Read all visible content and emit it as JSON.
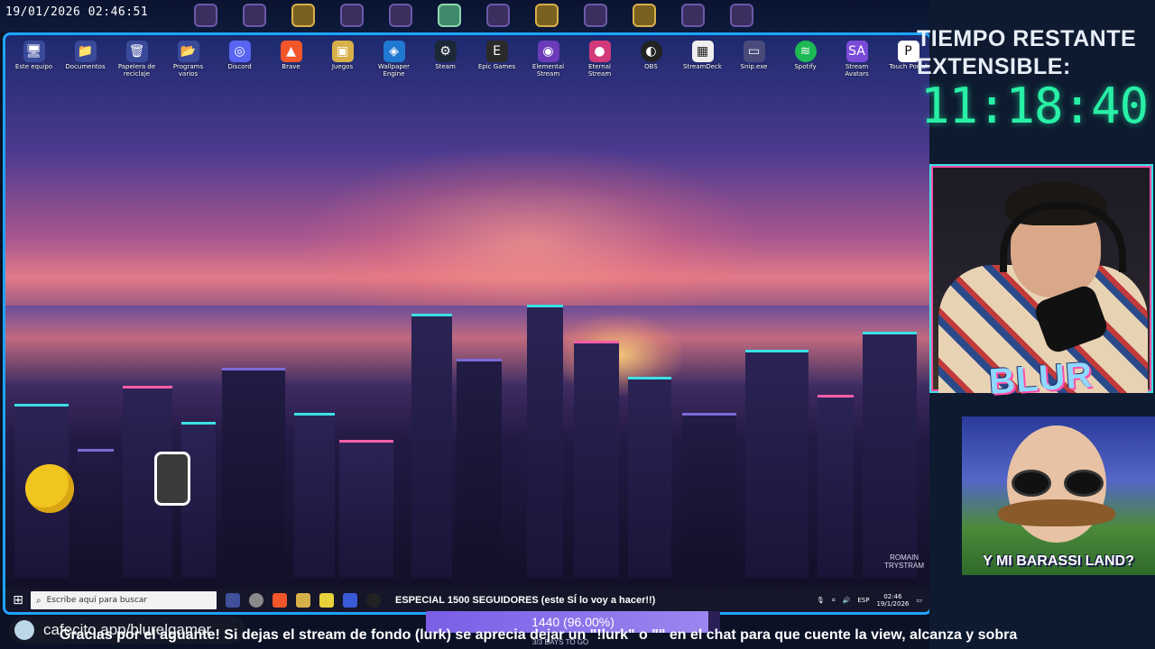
{
  "overlay": {
    "datetime": "19/01/2026 02:46:51",
    "timer_title_line1": "TIEMPO RESTANTE",
    "timer_title_line2": "EXTENSIBLE:",
    "timer_value": "11:18:40",
    "brand_logo": "BLUR",
    "meme_caption": "Y MI BARASSI LAND?",
    "goal_text": "1440 (96.00%)",
    "goal_progress": 0.96,
    "goal_sub": "3/3 DAYS TO GO",
    "cafecito": "cafecito.app/blurelgamer",
    "marquee": "Gracias por el aguante! Si dejas el stream de fondo (lurk) se aprecia dejar un \"!lurk\" o \"\" en el chat para que cuente la view, alcanza y sobra"
  },
  "desktop": {
    "icons": [
      {
        "name": "pc-icon",
        "label": "Este equipo"
      },
      {
        "name": "documents-icon",
        "label": "Documentos"
      },
      {
        "name": "recycle-bin-icon",
        "label": "Papelera de reciclaje"
      },
      {
        "name": "programs-icon",
        "label": "Programs varios"
      },
      {
        "name": "discord-icon",
        "label": "Discord"
      },
      {
        "name": "brave-icon",
        "label": "Brave"
      },
      {
        "name": "games-folder-icon",
        "label": "Juegos"
      },
      {
        "name": "wallpaper-engine-icon",
        "label": "Wallpaper Engine"
      },
      {
        "name": "steam-icon",
        "label": "Steam"
      },
      {
        "name": "epic-games-icon",
        "label": "Epic Games"
      },
      {
        "name": "stream-icon",
        "label": "Elemental Stream"
      },
      {
        "name": "eternal-stream-icon",
        "label": "Eternal Stream"
      },
      {
        "name": "obs-icon",
        "label": "OBS"
      },
      {
        "name": "streamdeck-icon",
        "label": "StreamDeck"
      },
      {
        "name": "exe-icon",
        "label": "Snip.exe"
      },
      {
        "name": "spotify-icon",
        "label": "Spotify"
      },
      {
        "name": "stream-avatars-icon",
        "label": "Stream Avatars"
      },
      {
        "name": "touch-portal-icon",
        "label": "Touch Portal"
      }
    ],
    "watermark_line1": "ROMAIN",
    "watermark_line2": "TRYSTRAM"
  },
  "taskbar": {
    "search_placeholder": "Escribe aquí para buscar",
    "ticker": "ESPECIAL 1500 SEGUIDORES (este SÍ lo voy a hacer!!)",
    "lang": "ESP",
    "time": "02:46",
    "date": "19/1/2026"
  }
}
